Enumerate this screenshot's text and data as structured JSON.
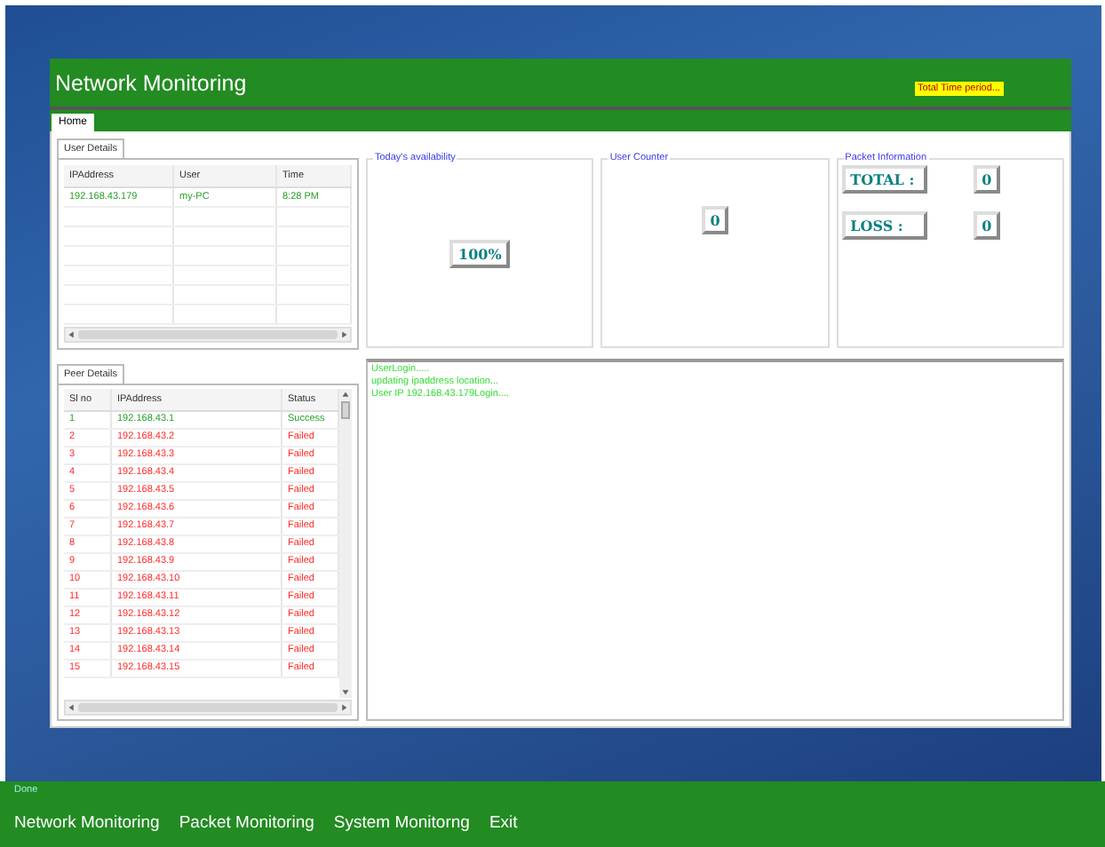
{
  "window": {
    "title": "Network Monitoring",
    "timer": "Total Time period..."
  },
  "tabs": [
    {
      "label": "Home",
      "selected": true
    }
  ],
  "user_details": {
    "title": "User Details",
    "columns": [
      "IPAddress",
      "User",
      "Time"
    ],
    "rows": [
      [
        "192.168.43.179",
        "my-PC",
        "8:28 PM"
      ]
    ]
  },
  "peer_details": {
    "title": "Peer Details",
    "columns": [
      "Sl no",
      "IPAddress",
      "Status"
    ],
    "rows": [
      {
        "no": "1",
        "ip": "192.168.43.1",
        "status": "Success",
        "kind": "success"
      },
      {
        "no": "2",
        "ip": "192.168.43.2",
        "status": "Failed",
        "kind": "failed"
      },
      {
        "no": "3",
        "ip": "192.168.43.3",
        "status": "Failed",
        "kind": "failed"
      },
      {
        "no": "4",
        "ip": "192.168.43.4",
        "status": "Failed",
        "kind": "failed"
      },
      {
        "no": "5",
        "ip": "192.168.43.5",
        "status": "Failed",
        "kind": "failed"
      },
      {
        "no": "6",
        "ip": "192.168.43.6",
        "status": "Failed",
        "kind": "failed"
      },
      {
        "no": "7",
        "ip": "192.168.43.7",
        "status": "Failed",
        "kind": "failed"
      },
      {
        "no": "8",
        "ip": "192.168.43.8",
        "status": "Failed",
        "kind": "failed"
      },
      {
        "no": "9",
        "ip": "192.168.43.9",
        "status": "Failed",
        "kind": "failed"
      },
      {
        "no": "10",
        "ip": "192.168.43.10",
        "status": "Failed",
        "kind": "failed"
      },
      {
        "no": "11",
        "ip": "192.168.43.11",
        "status": "Failed",
        "kind": "failed"
      },
      {
        "no": "12",
        "ip": "192.168.43.12",
        "status": "Failed",
        "kind": "failed"
      },
      {
        "no": "13",
        "ip": "192.168.43.13",
        "status": "Failed",
        "kind": "failed"
      },
      {
        "no": "14",
        "ip": "192.168.43.14",
        "status": "Failed",
        "kind": "failed"
      },
      {
        "no": "15",
        "ip": "192.168.43.15",
        "status": "Failed",
        "kind": "failed"
      }
    ]
  },
  "availability": {
    "title": "Today's availability",
    "value": "100%"
  },
  "user_counter": {
    "title": "User Counter",
    "value": "0"
  },
  "packet_information": {
    "title": "Packet Information",
    "rows": [
      {
        "label": "TOTAL :",
        "value": "0"
      },
      {
        "label": "LOSS :",
        "value": "0"
      }
    ]
  },
  "log": [
    "UserLogin.....",
    "updating ipaddress location...",
    "User IP 192.168.43.179Login...."
  ],
  "status_bar": {
    "text": "Done"
  },
  "menu": [
    "Network Monitoring",
    "Packet Monitoring",
    "System Monitorng",
    "Exit"
  ]
}
